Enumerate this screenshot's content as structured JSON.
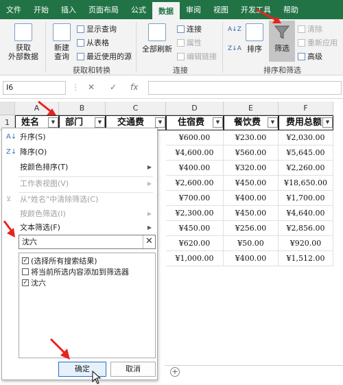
{
  "ribbon_tabs": [
    "文件",
    "开始",
    "插入",
    "页面布局",
    "公式",
    "数据",
    "审阅",
    "视图",
    "开发工具",
    "帮助"
  ],
  "ribbon": {
    "get_external": "获取\n外部数据",
    "new_query": "新建\n查询",
    "show_query": "显示查询",
    "from_table": "从表格",
    "recent_sources": "最近使用的源",
    "refresh_all": "全部刷新",
    "connections": "连接",
    "properties": "属性",
    "edit_links": "编辑链接",
    "sort": "排序",
    "filter": "筛选",
    "clear": "清除",
    "reapply": "重新应用",
    "advanced": "高级",
    "group_get_transform": "获取和转换",
    "group_connections": "连接",
    "group_sort_filter": "排序和筛选"
  },
  "formula_bar": {
    "name_box": "I6",
    "fx": "fx",
    "cancel": "✕",
    "enter": "✓"
  },
  "columns": [
    "A",
    "B",
    "C",
    "D",
    "E",
    "F"
  ],
  "row_numbers": [
    "1"
  ],
  "header_row": [
    "姓名",
    "部门",
    "交通费",
    "住宿费",
    "餐饮费",
    "费用总额"
  ],
  "data_rows": [
    [
      "¥600.00",
      "¥230.00",
      "¥2,030.00"
    ],
    [
      "¥4,600.00",
      "¥560.00",
      "¥5,645.00"
    ],
    [
      "¥400.00",
      "¥320.00",
      "¥2,260.00"
    ],
    [
      "¥2,600.00",
      "¥450.00",
      "¥18,650.00"
    ],
    [
      "¥700.00",
      "¥400.00",
      "¥1,700.00"
    ],
    [
      "¥2,300.00",
      "¥450.00",
      "¥4,640.00"
    ],
    [
      "¥450.00",
      "¥256.00",
      "¥2,856.00"
    ],
    [
      "¥620.00",
      "¥50.00",
      "¥920.00"
    ],
    [
      "¥1,000.00",
      "¥400.00",
      "¥1,512.00"
    ]
  ],
  "filter_menu": {
    "sort_asc": "升序(S)",
    "sort_desc": "降序(O)",
    "sort_by_color": "按颜色排序(T)",
    "sheet_view": "工作表视图(V)",
    "clear_filter": "从\"姓名\"中清除筛选(C)",
    "filter_by_color": "按颜色筛选(I)",
    "text_filter": "文本筛选(F)",
    "search_value": "沈六",
    "list": [
      {
        "label": "(选择所有搜索结果)",
        "checked": true
      },
      {
        "label": "将当前所选内容添加到筛选器",
        "checked": false
      },
      {
        "label": "沈六",
        "checked": true
      }
    ],
    "ok": "确定",
    "cancel": "取消"
  },
  "colors": {
    "excel_green": "#217346",
    "annotation_red": "#e8231e"
  }
}
